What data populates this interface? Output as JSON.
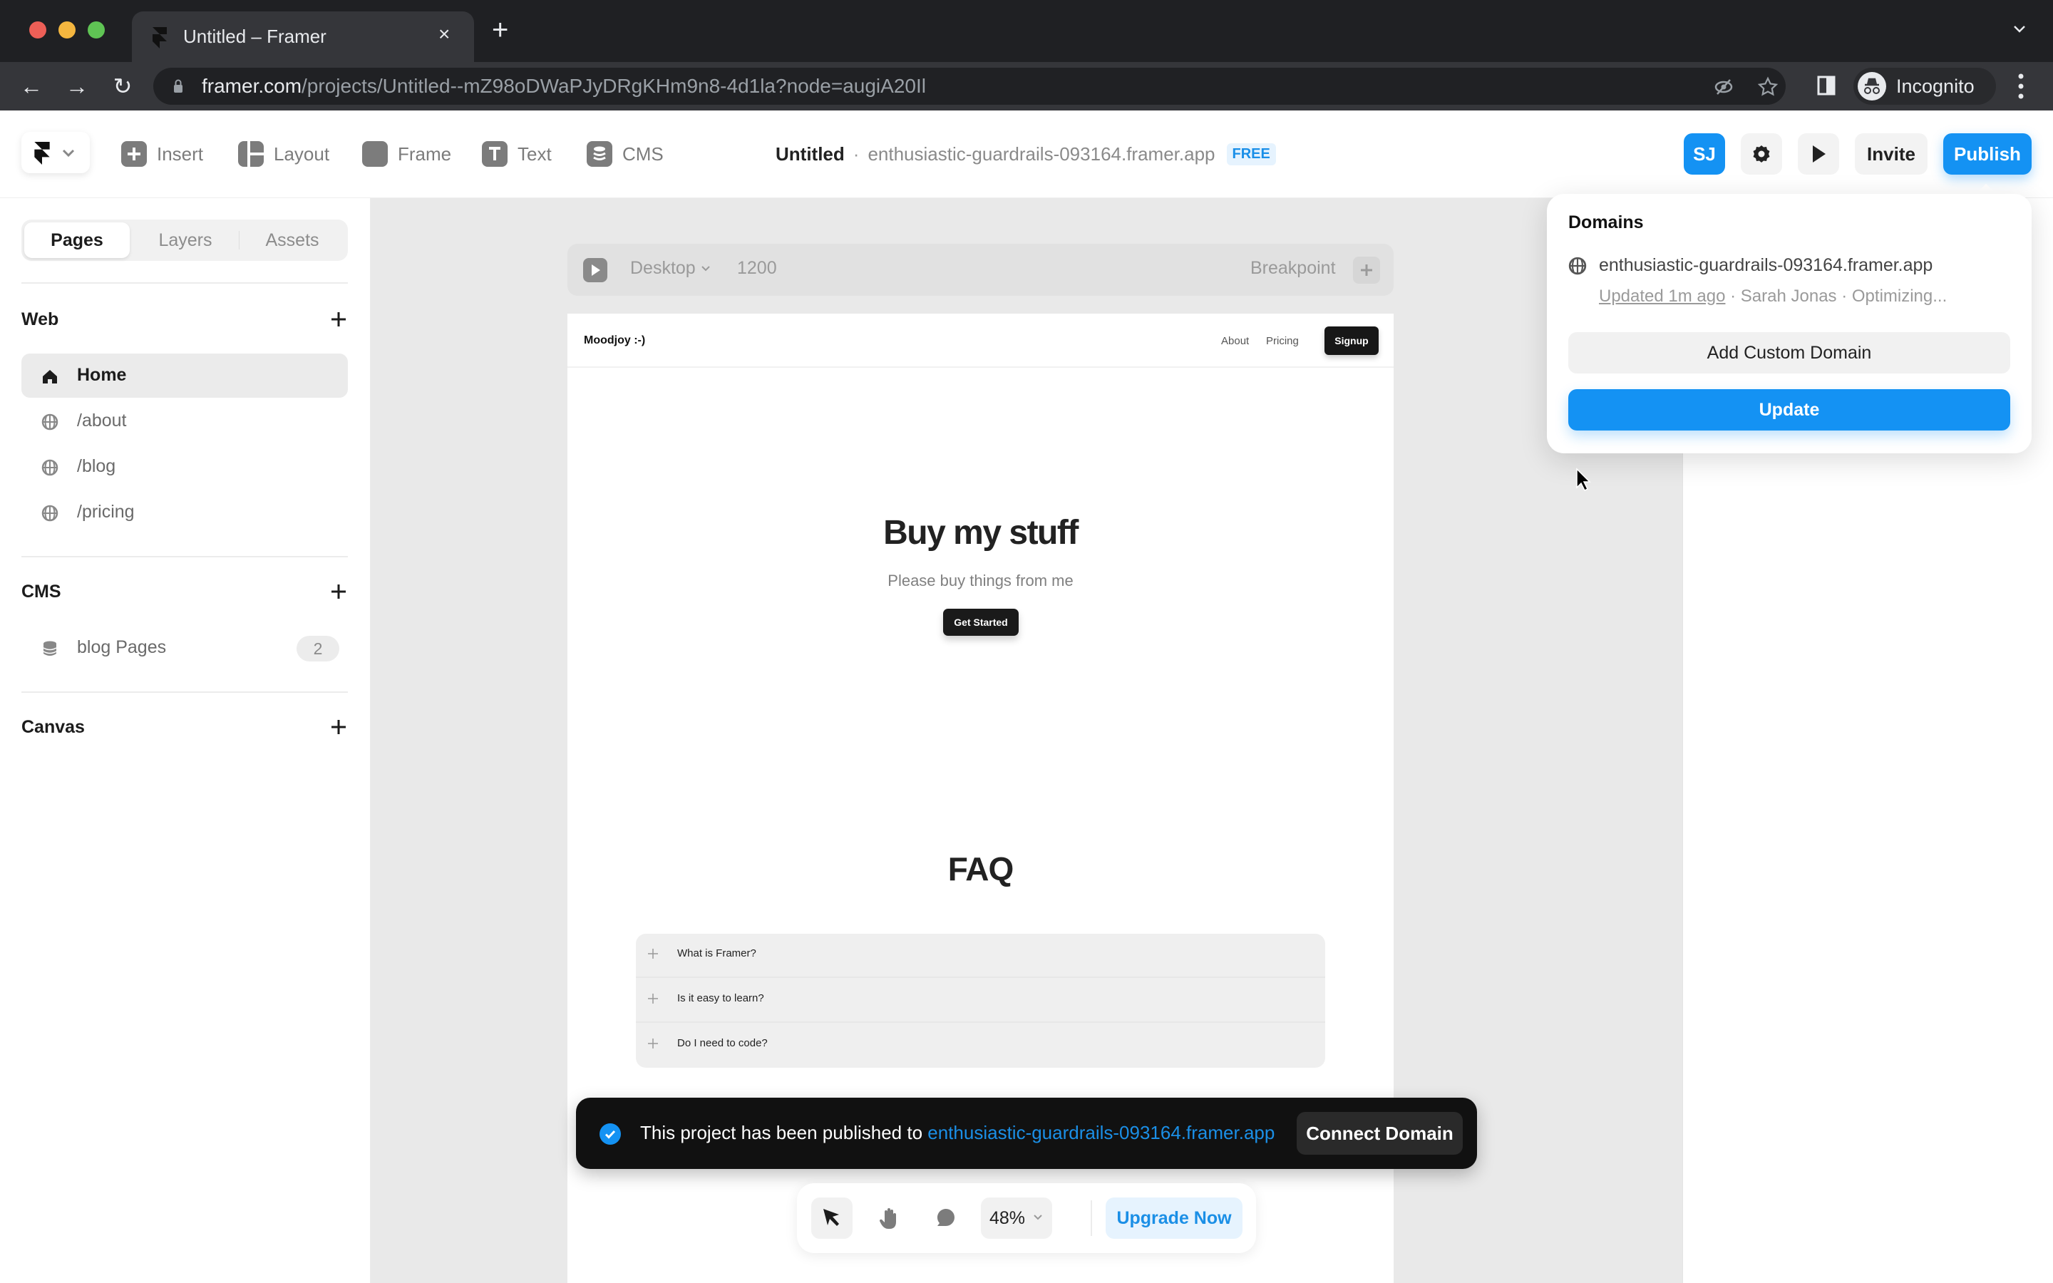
{
  "browser": {
    "tab_title": "Untitled – Framer",
    "tab_close": "×",
    "new_tab": "+",
    "url_host": "framer.com",
    "url_path": "/projects/Untitled--mZ98oDWaPJyDRgKHm9n8-4d1la?node=augiA20Il",
    "profile_label": "Incognito",
    "nav": {
      "back": "←",
      "forward": "→",
      "reload": "↻"
    }
  },
  "toolbar": {
    "tools": [
      {
        "label": "Insert",
        "icon": "plus-square-icon"
      },
      {
        "label": "Layout",
        "icon": "layout-icon"
      },
      {
        "label": "Frame",
        "icon": "frame-icon"
      },
      {
        "label": "Text",
        "icon": "text-icon"
      },
      {
        "label": "CMS",
        "icon": "database-icon"
      }
    ],
    "project_name": "Untitled",
    "separator": "·",
    "project_domain": "enthusiastic-guardrails-093164.framer.app",
    "plan_badge": "FREE",
    "avatar_initials": "SJ",
    "invite_label": "Invite",
    "publish_label": "Publish"
  },
  "sidebar": {
    "tabs": [
      {
        "label": "Pages",
        "active": true
      },
      {
        "label": "Layers",
        "active": false
      },
      {
        "label": "Assets",
        "active": false
      }
    ],
    "sections": {
      "web": {
        "heading": "Web",
        "items": [
          {
            "label": "Home",
            "icon": "home-icon",
            "active": true
          },
          {
            "label": "/about",
            "icon": "globe-icon",
            "active": false
          },
          {
            "label": "/blog",
            "icon": "globe-icon",
            "active": false
          },
          {
            "label": "/pricing",
            "icon": "globe-icon",
            "active": false
          }
        ]
      },
      "cms": {
        "heading": "CMS",
        "items": [
          {
            "label": "blog Pages",
            "icon": "database-icon",
            "count": "2"
          }
        ]
      },
      "canvas": {
        "heading": "Canvas"
      }
    }
  },
  "frame_bar": {
    "device": "Desktop",
    "width": "1200",
    "breakpoint_label": "Breakpoint"
  },
  "site": {
    "logo": "Moodjoy :-)",
    "nav_links": [
      "About",
      "Pricing"
    ],
    "signup": "Signup",
    "hero_title": "Buy my stuff",
    "hero_subtitle": "Please buy things from me",
    "hero_cta": "Get Started",
    "faq_title": "FAQ",
    "faq_items": [
      "What is Framer?",
      "Is it easy to learn?",
      "Do I need to code?"
    ]
  },
  "domains_popover": {
    "title": "Domains",
    "domain": "enthusiastic-guardrails-093164.framer.app",
    "updated": "Updated 1m ago",
    "meta_rest": " · Sarah Jonas · Optimizing...",
    "add_custom_domain": "Add Custom Domain",
    "update": "Update"
  },
  "toast": {
    "message": "This project has been published to ",
    "link": "enthusiastic-guardrails-093164.framer.app",
    "action": "Connect Domain"
  },
  "bottom_toolbar": {
    "zoom": "48%",
    "upgrade": "Upgrade Now"
  },
  "colors": {
    "accent": "#1492f3",
    "link": "#1b8fe6",
    "canvas_bg": "#e9e9e9",
    "toast_bg": "#111111"
  }
}
